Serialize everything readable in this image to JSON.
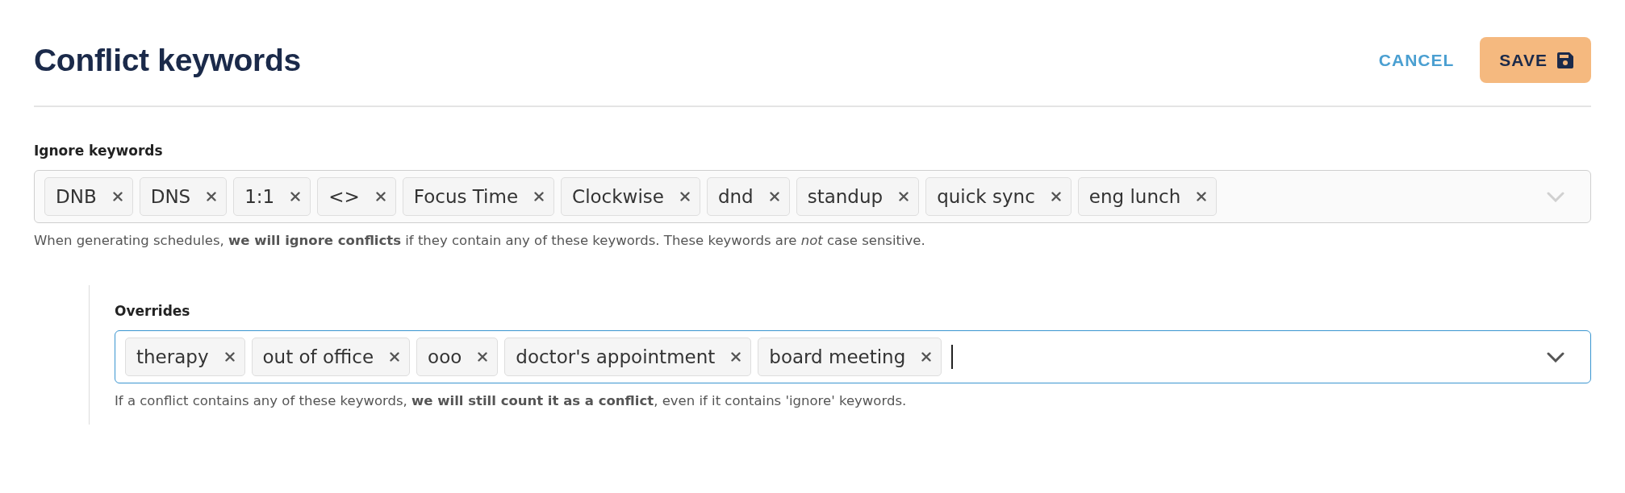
{
  "header": {
    "title": "Conflict keywords",
    "cancel": "CANCEL",
    "save": "SAVE"
  },
  "sections": [
    {
      "label": "Ignore keywords",
      "nested": false,
      "focused": false,
      "help": "When generating schedules, **we will ignore conflicts** if they contain any of these keywords. These keywords are *not* case sensitive.",
      "tags": [
        "DNB",
        "DNS",
        "1:1",
        "<>",
        "Focus Time",
        "Clockwise",
        "dnd",
        "standup",
        "quick sync",
        "eng lunch"
      ]
    },
    {
      "label": "Overrides",
      "nested": true,
      "focused": true,
      "help": "If a conflict contains any of these keywords, **we will still count it as a conflict**, even if it contains 'ignore' keywords.",
      "tags": [
        "therapy",
        "out of office",
        "ooo",
        "doctor's appointment",
        "board meeting"
      ]
    }
  ]
}
